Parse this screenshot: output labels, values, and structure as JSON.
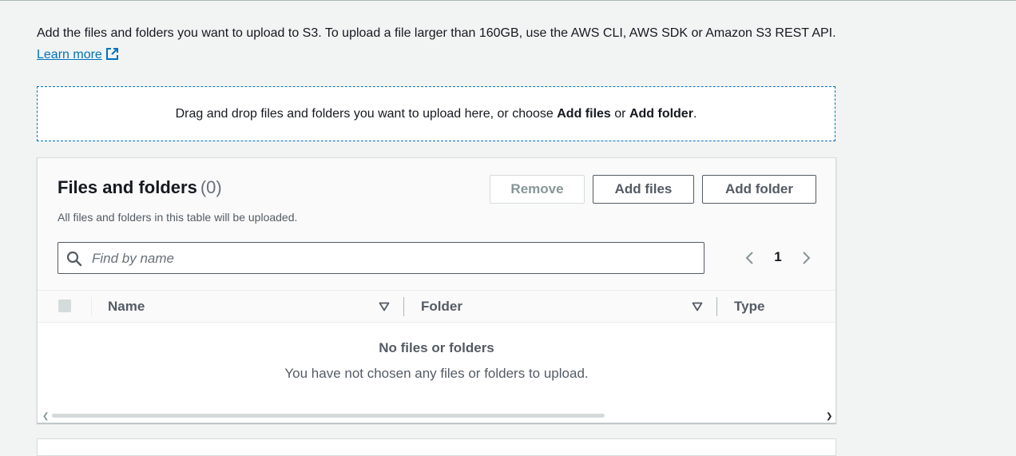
{
  "intro": {
    "text": "Add the files and folders you want to upload to S3. To upload a file larger than 160GB, use the AWS CLI, AWS SDK or Amazon S3 REST API.",
    "learn_more": "Learn more"
  },
  "dropzone": {
    "text_before": "Drag and drop files and folders you want to upload here, or choose ",
    "add_files": "Add files",
    "or": " or ",
    "add_folder": "Add folder",
    "period": "."
  },
  "panel": {
    "title": "Files and folders",
    "count": "(0)",
    "description": "All files and folders in this table will be uploaded.",
    "buttons": {
      "remove": "Remove",
      "add_files": "Add files",
      "add_folder": "Add folder"
    },
    "search": {
      "placeholder": "Find by name",
      "value": ""
    },
    "pagination": {
      "current_page": "1"
    },
    "columns": [
      "Name",
      "Folder",
      "Type"
    ],
    "empty": {
      "title": "No files or folders",
      "description": "You have not chosen any files or folders to upload."
    }
  },
  "icons": {
    "external_link": "external-link-icon",
    "search": "search-icon",
    "sort": "caret-down-icon",
    "prev": "chevron-left-icon",
    "next": "chevron-right-icon"
  },
  "colors": {
    "link": "#0073bb",
    "text": "#16191f",
    "secondary": "#545b64",
    "background": "#f2f3f3"
  }
}
